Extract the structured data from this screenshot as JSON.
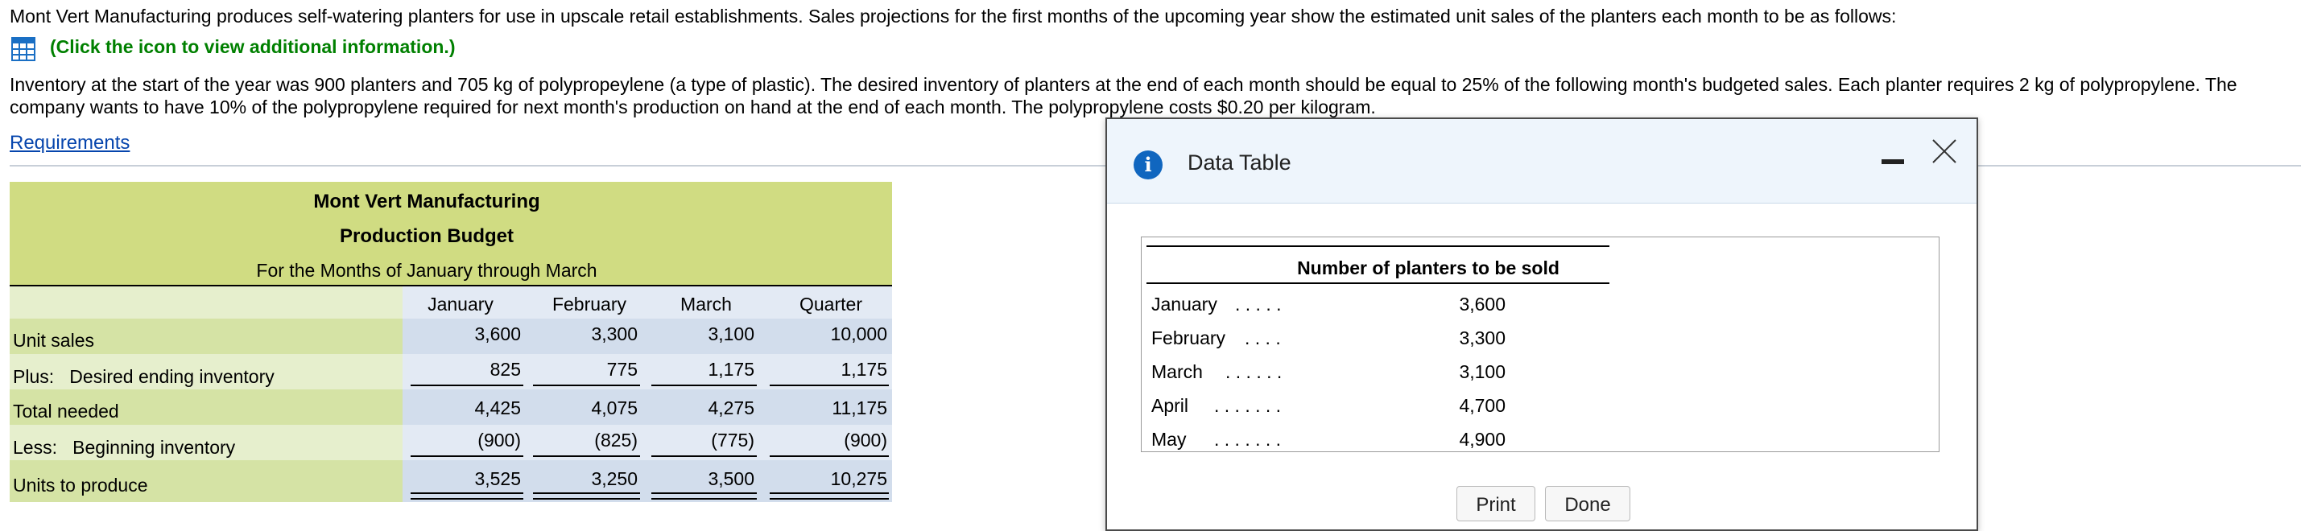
{
  "intro": {
    "line1": "Mont Vert Manufacturing produces self-watering planters for use in upscale retail establishments. Sales projections for the first months of the upcoming year show the estimated unit sales of the planters each month to be as follows:",
    "click_info": "(Click the icon to view additional information.)",
    "line2a": "Inventory at the start of the year was 900 planters and 705 kg of polypropeylene (a type of plastic). The desired inventory of planters at the end of each month should be equal to 25% of the following month's budgeted sales. Each planter requires 2 kg of polypropylene. The",
    "line2b": "company wants to have 10% of the polypropylene required for next month's production on hand at the end of each month. The polypropylene costs $0.20 per kilogram.",
    "requirements_link": "Requirements"
  },
  "budget": {
    "company": "Mont Vert Manufacturing",
    "title": "Production Budget",
    "period": "For the Months of January through March",
    "columns": [
      "January",
      "February",
      "March",
      "Quarter"
    ],
    "rows": [
      {
        "label": "Unit sales",
        "values": [
          "3,600",
          "3,300",
          "3,100",
          "10,000"
        ]
      },
      {
        "label": "Plus:   Desired ending inventory",
        "values": [
          "825",
          "775",
          "1,175",
          "1,175"
        ]
      },
      {
        "label": "Total needed",
        "values": [
          "4,425",
          "4,075",
          "4,275",
          "11,175"
        ]
      },
      {
        "label": "Less:   Beginning inventory",
        "values": [
          "(900)",
          "(825)",
          "(775)",
          "(900)"
        ]
      },
      {
        "label": "Units to produce",
        "values": [
          "3,525",
          "3,250",
          "3,500",
          "10,275"
        ]
      }
    ]
  },
  "modal": {
    "title": "Data Table",
    "table_header": "Number of planters to be sold",
    "rows": [
      {
        "month": "January",
        "dots": ". . . . .",
        "value": "3,600"
      },
      {
        "month": "February",
        "dots": ". . . .",
        "value": "3,300"
      },
      {
        "month": "March",
        "dots": ". . . . . .",
        "value": "3,100"
      },
      {
        "month": "April",
        "dots": ". . . . . . .",
        "value": "4,700"
      },
      {
        "month": "May",
        "dots": ". . . . . . .",
        "value": "4,900"
      }
    ],
    "print_label": "Print",
    "done_label": "Done"
  },
  "colors": {
    "header_green": "#d0dc82",
    "label_green_dark": "#d5e3a5",
    "label_green_light": "#e6efcd",
    "value_blue_dark": "#d2ddec",
    "value_blue_light": "#e3eaf4",
    "link_blue": "#0645ad",
    "info_blue": "#1066bf"
  }
}
